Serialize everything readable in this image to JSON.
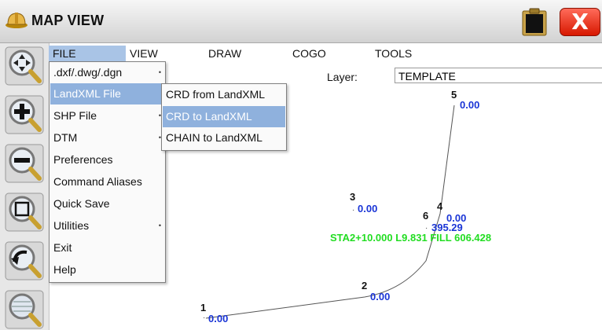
{
  "window": {
    "title": "MAP VIEW",
    "close_label": "X",
    "close_color": "#e02000"
  },
  "menubar": {
    "items": [
      {
        "id": "file",
        "label": "FILE"
      },
      {
        "id": "view",
        "label": "VIEW"
      },
      {
        "id": "draw",
        "label": "DRAW"
      },
      {
        "id": "cogo",
        "label": "COGO"
      },
      {
        "id": "tools",
        "label": "TOOLS"
      }
    ],
    "active": "FILE"
  },
  "layer": {
    "label": "Layer:",
    "value": "TEMPLATE"
  },
  "toolbar": {
    "icons": [
      "pan-icon",
      "zoom-in-icon",
      "zoom-out-icon",
      "zoom-window-icon",
      "zoom-previous-icon",
      "zoom-extents-icon"
    ]
  },
  "file_menu": {
    "items": [
      {
        "label": ".dxf/.dwg/.dgn",
        "submenu": true
      },
      {
        "label": "LandXML File",
        "submenu": true,
        "selected": true
      },
      {
        "label": "SHP File",
        "submenu": true
      },
      {
        "label": "DTM",
        "submenu": true
      },
      {
        "label": "Preferences"
      },
      {
        "label": "Command Aliases"
      },
      {
        "label": "Quick Save"
      },
      {
        "label": "Utilities",
        "submenu": true
      },
      {
        "label": "Exit"
      },
      {
        "label": "Help"
      }
    ],
    "submenu_arrow": "•"
  },
  "landxml_submenu": {
    "items": [
      {
        "label": "CRD from LandXML"
      },
      {
        "label": "CRD to LandXML",
        "selected": true
      },
      {
        "label": "CHAIN to LandXML"
      }
    ]
  },
  "map": {
    "points": [
      {
        "id": "1",
        "elev": "0.00"
      },
      {
        "id": "2",
        "elev": "0.00"
      },
      {
        "id": "3",
        "elev": "0.00"
      },
      {
        "id": "4",
        "elev": "0.00"
      },
      {
        "id": "5",
        "elev": "0.00"
      },
      {
        "id": "6",
        "elev": "395.29"
      }
    ],
    "station_label": "STA2+10.000 L9.831 FILL 606.428",
    "colors": {
      "point_number": "#111111",
      "elevation": "#1a35d6",
      "station": "#22dd22",
      "line": "#555555"
    }
  }
}
